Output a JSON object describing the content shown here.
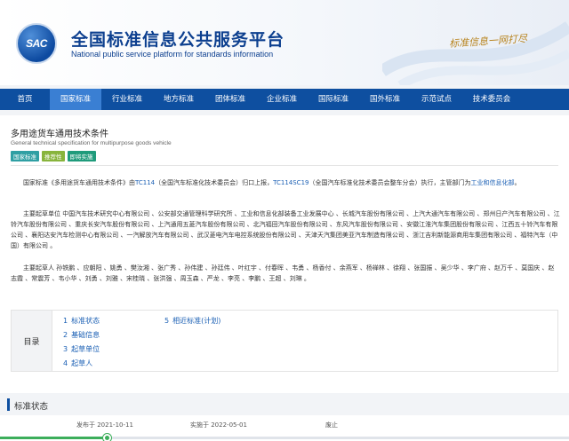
{
  "header": {
    "logo_text": "SAC",
    "title": "全国标准信息公共服务平台",
    "subtitle": "National public service platform  for standards information",
    "slogan": "标准信息一网打尽"
  },
  "nav": {
    "items": [
      {
        "label": "首页",
        "active": false
      },
      {
        "label": "国家标准",
        "active": true
      },
      {
        "label": "行业标准",
        "active": false
      },
      {
        "label": "地方标准",
        "active": false
      },
      {
        "label": "团体标准",
        "active": false
      },
      {
        "label": "企业标准",
        "active": false
      },
      {
        "label": "国际标准",
        "active": false
      },
      {
        "label": "国外标准",
        "active": false
      },
      {
        "label": "示范试点",
        "active": false
      },
      {
        "label": "技术委员会",
        "active": false
      }
    ]
  },
  "standard": {
    "title": "多用途货车通用技术条件",
    "subtitle": "General technical specification for multipurpose goods vehicle",
    "badges": [
      "国家标准",
      "推荐性",
      "即将实施"
    ]
  },
  "paragraphs": {
    "p1_a": "国家标准《多用途货车通用技术条件》由",
    "p1_tc": "TC114",
    "p1_b": "（全国汽车标准化技术委员会）归口上报，",
    "p1_sc": "TC114SC19",
    "p1_c": "（全国汽车标准化技术委员会整车分会）执行，主管部门为",
    "p1_dept": "工业和信息化部",
    "p1_end": "。",
    "p2": "主要起草单位 中国汽车技术研究中心有限公司 、公安部交通管理科学研究所 、工业和信息化部装备工业发展中心 、长城汽车股份有限公司 、上汽大通汽车有限公司 、郑州日产汽车有限公司 、江铃汽车股份有限公司 、重庆长安汽车股份有限公司 、上汽通用五菱汽车股份有限公司 、北汽福田汽车股份有限公司 、东风汽车股份有限公司 、安徽江淮汽车集团股份有限公司 、江西五十铃汽车有限公司 、襄阳达安汽车检测中心有限公司 、一汽解放汽车有限公司 、武汉菱电汽车电控系统股份有限公司 、天津天汽集团美亚汽车制造有限公司 、浙江吉利新能源商用车集团有限公司 、福特汽车（中国）有限公司 。",
    "p3": "主要起草人 孙铁鹏 、应朝阳 、姚勇 、樊汝湘 、张广秀 、孙伟建 、孙廷伟 、叶红宇 、付春晖 、韦勇 、杨香付 、余燕军 、杨禅林 、徐翔 、张国振 、吴少华 、李广府 、赵万千 、莫国庆 、赵志霞 、常震芳 、韦小华 、刘勇 、刘雅 、宋桂晓 、张洪强 、周玉森 、严龙 、李亮 、李鹏 、王超 、刘琳 。"
  },
  "toc": {
    "label": "目录",
    "items": [
      {
        "num": "1",
        "label": "标准状态"
      },
      {
        "num": "2",
        "label": "基础信息"
      },
      {
        "num": "3",
        "label": "起草单位"
      },
      {
        "num": "4",
        "label": "起草人"
      },
      {
        "num": "5",
        "label": "相近标准(计划)"
      }
    ]
  },
  "status_section": {
    "title": "标准状态",
    "publish": "发布于 2021-10-11",
    "implement": "实施于 2022-05-01",
    "abolish": "废止",
    "abolish_value": "—"
  }
}
